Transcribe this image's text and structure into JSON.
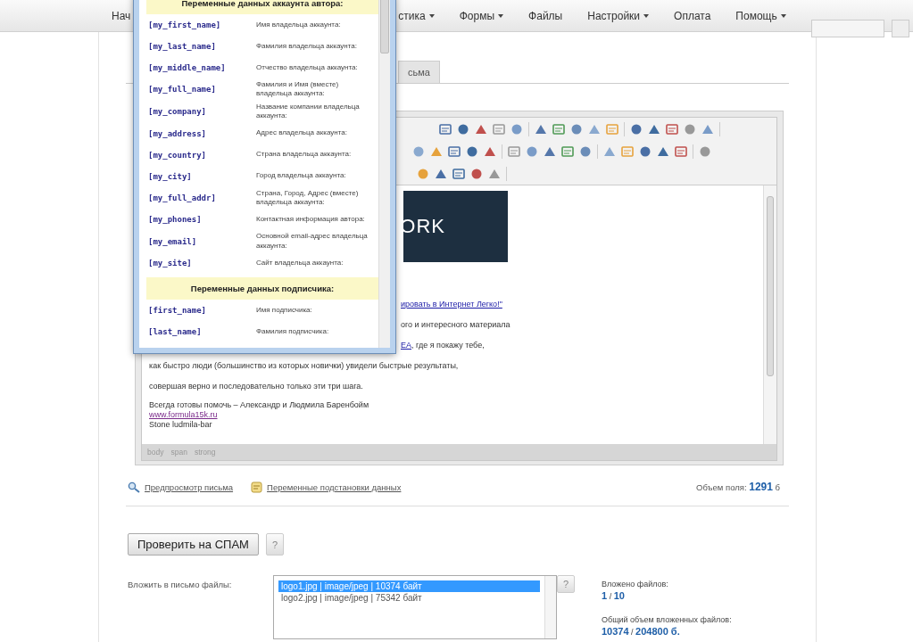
{
  "nav": [
    {
      "label": "Нач",
      "has_menu": false
    },
    {
      "label": "стика",
      "has_menu": true
    },
    {
      "label": "Формы",
      "has_menu": true
    },
    {
      "label": "Файлы",
      "has_menu": false
    },
    {
      "label": "Настройки",
      "has_menu": true
    },
    {
      "label": "Оплата",
      "has_menu": false
    },
    {
      "label": "Помощь",
      "has_menu": true
    }
  ],
  "tabs": [
    {
      "label": "сьма",
      "selected": false
    }
  ],
  "variables_popup": {
    "sections": [
      {
        "title": "Переменные данных аккаунта автора:",
        "items": [
          {
            "name": "[my_first_name]",
            "description": "Имя владельца аккаунта:"
          },
          {
            "name": "[my_last_name]",
            "description": "Фамилия владельца аккаунта:"
          },
          {
            "name": "[my_middle_name]",
            "description": "Отчество владельца аккаунта:"
          },
          {
            "name": "[my_full_name]",
            "description": "Фамилия и Имя (вместе) владельца аккаунта:"
          },
          {
            "name": "[my_company]",
            "description": "Название компании владельца аккаунта:"
          },
          {
            "name": "[my_address]",
            "description": "Адрес владельца аккаунта:"
          },
          {
            "name": "[my_country]",
            "description": "Страна владельца аккаунта:"
          },
          {
            "name": "[my_city]",
            "description": "Город владельца аккаунта:"
          },
          {
            "name": "[my_full_addr]",
            "description": "Страна, Город, Адрес (вместе) владельца аккаунта:"
          },
          {
            "name": "[my_phones]",
            "description": "Контактная информация автора:"
          },
          {
            "name": "[my_email]",
            "description": "Основной email-адрес владельца аккаунта:"
          },
          {
            "name": "[my_site]",
            "description": "Сайт владельца аккаунта:"
          }
        ]
      },
      {
        "title": "Переменные данных подписчика:",
        "items": [
          {
            "name": "[first_name]",
            "description": "Имя подписчика:"
          },
          {
            "name": "[last_name]",
            "description": "Фамилия подписчика:"
          }
        ]
      }
    ]
  },
  "editor": {
    "logo_text": "ORK",
    "lines": [
      {
        "kind": "partial",
        "segments": [
          {
            "text": "ировать в Интернет Легко!\"",
            "link": true
          }
        ]
      },
      {
        "kind": "partial",
        "segments": [
          {
            "text": "ого и  интересного материала",
            "link": false
          }
        ]
      },
      {
        "kind": "partial",
        "segments": [
          {
            "text": "ЕА",
            "link": true
          },
          {
            "text": ", где я покажу тебе,",
            "link": false
          }
        ]
      },
      {
        "kind": "full",
        "segments": [
          {
            "text": "как быстро люди (большинство из которых новички) увидели быстрые результаты,",
            "link": false
          }
        ]
      },
      {
        "kind": "full",
        "segments": [
          {
            "text": "совершая верно и последовательно  только эти три шага.",
            "link": false
          }
        ]
      },
      {
        "kind": "blank"
      },
      {
        "kind": "tight",
        "segments": [
          {
            "text": "Всегда готовы помочь – Александр и Людмила Баренбойм",
            "link": false
          }
        ]
      },
      {
        "kind": "tight",
        "segments": [
          {
            "text": "www.formula15k.ru",
            "link": true,
            "visited": true
          }
        ]
      },
      {
        "kind": "tight",
        "segments": [
          {
            "text": "Stone ludmila-bar",
            "link": false
          }
        ]
      }
    ],
    "path": [
      "body",
      "span",
      "strong"
    ]
  },
  "links": [
    {
      "label": "Предпросмотр письма"
    },
    {
      "label": "Переменные подстановки данных"
    }
  ],
  "field_size": {
    "label": "Объем поля:",
    "value": "1291",
    "unit": "б"
  },
  "spam_button": "Проверить на СПАМ",
  "help_mark": "?",
  "attach": {
    "label": "Вложить в письмо файлы:",
    "files": [
      {
        "text": "logo1.jpg | image/jpeg | 10374 байт",
        "selected": true
      },
      {
        "text": "logo2.jpg | image/jpeg | 75342 байт",
        "selected": false
      }
    ],
    "count_label": "Вложено файлов:",
    "count": "1",
    "separator": "/",
    "count_max": "10",
    "size_label": "Общий объем вложенных файлов:",
    "size": "10374",
    "size_max": "204800 б."
  }
}
